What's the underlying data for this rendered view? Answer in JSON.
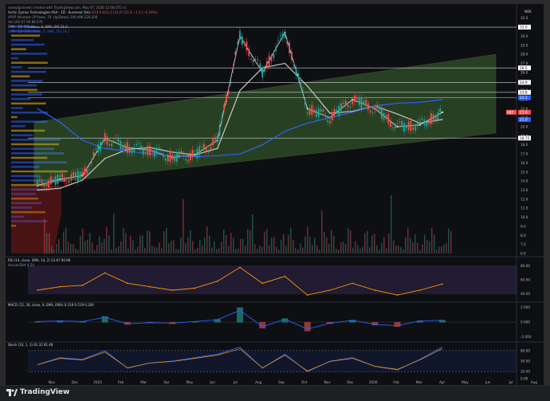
{
  "watermark": "savepigsinvest created with TradingView.com, May 07, 2026 12:08 UTC+2",
  "currency": "NOK",
  "symbol": {
    "name": "Arctic Zymes Technologies ASA · 1D · Euronext Oslo",
    "ohlc": "O23.0 H23.2 L21.6 C21.6 −1.2 (−5.26%)",
    "vol_bar": "%67.5%"
  },
  "indicators": {
    "vpvp": "VPVP (Number Of Rows, 70, Up/Down) 246.49K 226.42K",
    "vol": "Vol (20) 67.5K 86.07K",
    "sma50": "SMA · 1D (50, close, 0, SMA, 50) 21.0",
    "sma200": "SMA · 1D (200, close, 0, SMA, 50) 19.3"
  },
  "price_axis": {
    "ticks": [
      "32.0",
      "31.0",
      "30.0",
      "29.0",
      "28.0",
      "27.0",
      "26.0",
      "25.0",
      "24.0",
      "23.0",
      "22.0",
      "21.0",
      "20.0",
      "19.0",
      "18.0",
      "17.0",
      "16.0",
      "15.0",
      "14.0",
      "13.0",
      "12.0",
      "11.0",
      "10.0",
      "9.0",
      "8.0",
      "7.0",
      "6.0"
    ],
    "labels": [
      {
        "value": 31.0,
        "text": "31.0",
        "color": "#ffffff",
        "fg": "#000000"
      },
      {
        "value": 26.5,
        "text": "26.5",
        "color": "#ffffff",
        "fg": "#000000"
      },
      {
        "value": 24.9,
        "text": "24.9",
        "color": "#ffffff",
        "fg": "#000000"
      },
      {
        "value": 23.8,
        "text": "23.8",
        "color": "#ffffff",
        "fg": "#000000"
      },
      {
        "value": 23.2,
        "text": "23.2",
        "color": "#2962ff",
        "fg": "#ffffff"
      },
      {
        "value": 21.6,
        "text": "21.6",
        "color": "#ef5350",
        "fg": "#ffffff"
      },
      {
        "value": 20.8,
        "text": "21.0",
        "color": "#2962ff",
        "fg": "#ffffff"
      },
      {
        "value": 18.75,
        "text": "18.75",
        "color": "#ffffff",
        "fg": "#000000"
      }
    ],
    "ath_label": "ABZ"
  },
  "levels": [
    31.0,
    26.5,
    24.9,
    23.8,
    23.2,
    18.75
  ],
  "time_axis": [
    "Nov",
    "Dec",
    "2025",
    "Feb",
    "Mar",
    "Apr",
    "May",
    "Jun",
    "Jul",
    "Aug",
    "Sep",
    "Oct",
    "Nov",
    "Dec",
    "2026",
    "Feb",
    "Mar",
    "Apr",
    "May",
    "Jun",
    "Jul",
    "Aug"
  ],
  "rsi": {
    "label": "RSI (14, close, SMA, 14, 2) 53.67 60.98",
    "sub": "Accum/Dist 4.54",
    "levels": [
      "80.00",
      "60.00",
      "40.00"
    ]
  },
  "macd": {
    "label": "MACD (12, 26, close, 9, EMA, EMA) 0.319 0.519 0.200",
    "levels": [
      "2.000",
      "0.000",
      "-2.000"
    ]
  },
  "stoch": {
    "label": "Stoch (14, 1, 3) 91.32 81.48",
    "levels": [
      "80.00",
      "50.00",
      "20.00",
      "0.00"
    ]
  },
  "logo": "TradingView",
  "chart_data": {
    "type": "line",
    "title": "Arctic Zymes Technologies ASA · 1D · Euronext Oslo",
    "xlabel": "",
    "ylabel": "",
    "ylim": [
      6,
      32.5
    ],
    "x": [
      "Nov 2024",
      "Dec 2024",
      "Jan 2025",
      "Feb 2025",
      "Mar 2025",
      "Apr 2025",
      "May 2025",
      "Jun 2025",
      "Jul 2025",
      "Aug 2025",
      "Sep 2025",
      "Oct 2025",
      "Nov 2025",
      "Dec 2025",
      "Jan 2026",
      "Feb 2026",
      "Mar 2026",
      "Apr 2026",
      "May 2026"
    ],
    "series": [
      {
        "name": "close",
        "values": [
          13.5,
          14.2,
          14.6,
          18.7,
          17.7,
          17.4,
          16.6,
          16.9,
          18.5,
          30.0,
          26.0,
          30.4,
          22.0,
          21.0,
          23.0,
          22.0,
          20.0,
          20.2,
          21.6
        ]
      },
      {
        "name": "SMA 50",
        "values": [
          13.0,
          13.2,
          14.1,
          16.5,
          17.5,
          17.7,
          17.2,
          16.9,
          17.6,
          24.0,
          26.5,
          27.0,
          24.5,
          21.5,
          21.7,
          22.3,
          21.4,
          20.4,
          20.8
        ]
      },
      {
        "name": "SMA 200",
        "values": [
          22.0,
          20.5,
          18.5,
          17.6,
          17.3,
          17.0,
          16.8,
          16.7,
          16.8,
          17.0,
          18.0,
          19.5,
          20.4,
          21.0,
          21.6,
          22.3,
          22.6,
          22.7,
          23.0
        ]
      }
    ],
    "channel": {
      "upper_start": 20.5,
      "upper_end": 28.0,
      "lower_start": 13.6,
      "lower_end": 19.3
    },
    "rsi_values": [
      45,
      50,
      52,
      70,
      55,
      50,
      45,
      48,
      58,
      78,
      55,
      65,
      38,
      45,
      55,
      45,
      38,
      45,
      54
    ],
    "macd_values": [
      0.1,
      0.2,
      0.1,
      0.8,
      -0.3,
      -0.1,
      -0.2,
      0.1,
      0.4,
      2.0,
      -0.8,
      0.5,
      -1.2,
      -0.2,
      0.3,
      -0.4,
      -0.6,
      0.2,
      0.3
    ],
    "stoch_values": [
      40,
      60,
      55,
      80,
      30,
      45,
      50,
      60,
      70,
      90,
      30,
      70,
      20,
      50,
      60,
      35,
      25,
      55,
      91
    ]
  }
}
